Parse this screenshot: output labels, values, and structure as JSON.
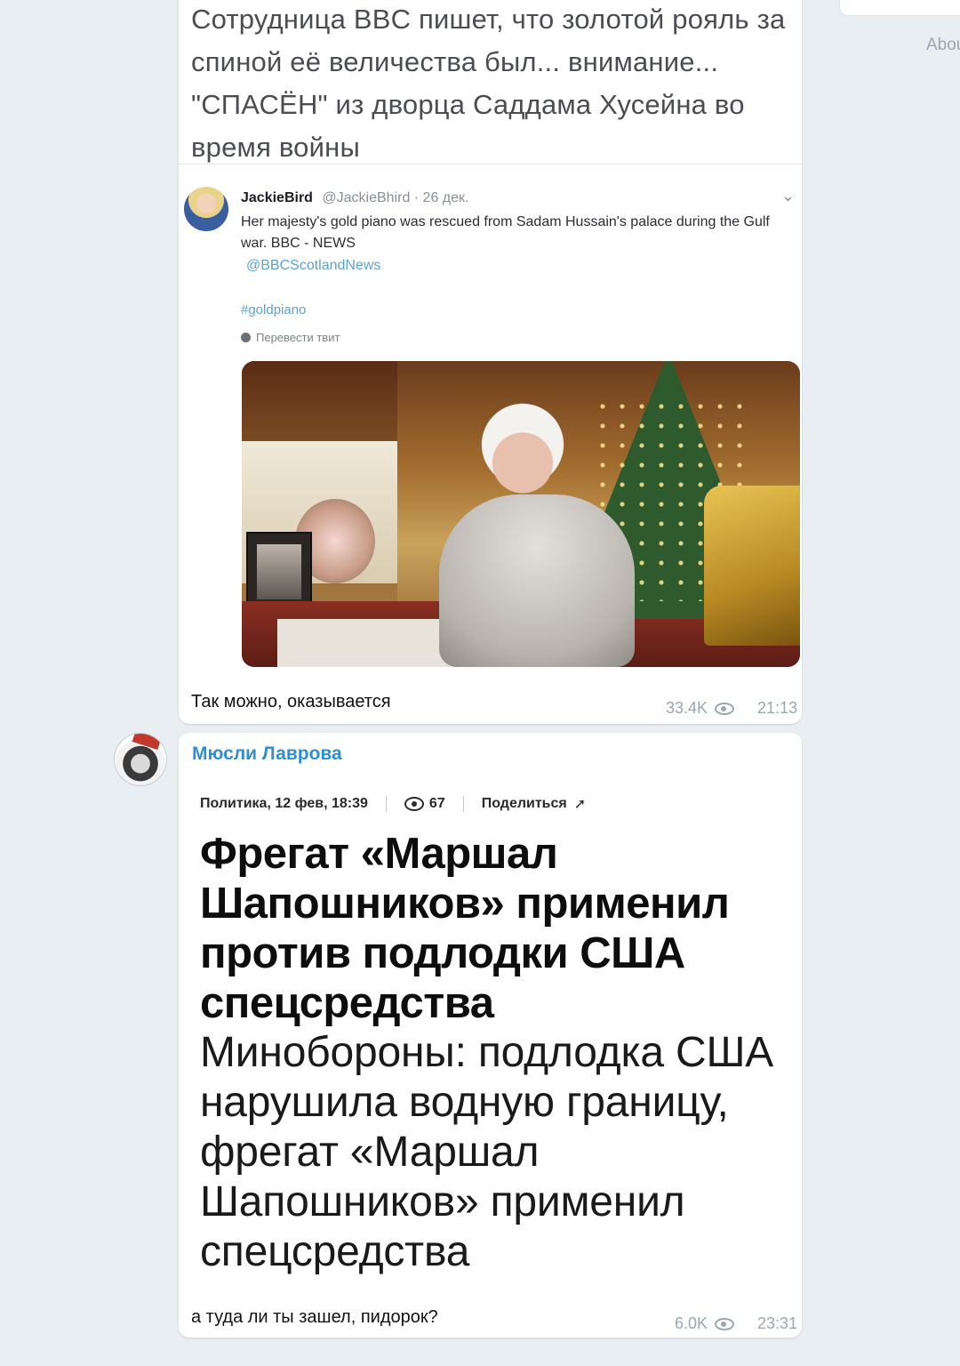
{
  "sidebar": {
    "about_link": "Abou"
  },
  "messages": [
    {
      "tweet_screenshot": {
        "caption": "Сотрудница BBC пишет, что золотой рояль за спиной её величества был... внимание... \"СПАСЁН\" из дворца Саддама Хусейна во время войны",
        "author_name": "JackieBird",
        "author_handle": "@JackieBhird · 26 дек.",
        "text": "Her majesty's gold piano was rescued from Sadam Hussain's palace during the Gulf war. BBC - NEWS",
        "mention": "@BBCScotlandNews",
        "hashtag": "#goldpiano",
        "translate": "Перевести твит"
      },
      "text": "Так можно, оказывается",
      "views": "33.4K",
      "time": "21:13"
    },
    {
      "channel_name": "Мюсли Лаврова",
      "news_card": {
        "meta_category": "Политика, 12 фев, 18:39",
        "meta_views": "67",
        "meta_share": "Поделиться",
        "headline": "Фрегат «Маршал Шапошников» применил против подлодки США спецсредства",
        "subheadline": "Минобороны: подлодка США нарушила водную границу, фрегат «Маршал Шапошников» применил спецсредства"
      },
      "text": "а туда ли ты зашел, пидорок?",
      "views": "6.0K",
      "time": "23:31"
    }
  ]
}
